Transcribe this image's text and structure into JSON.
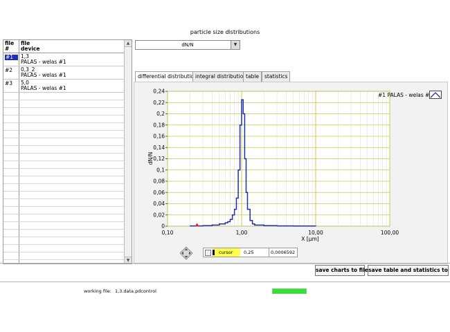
{
  "window": {
    "title": "particle size distributions"
  },
  "file_table": {
    "headers": {
      "file_num": "file\n#",
      "file_device": "file\ndevice"
    },
    "rows": [
      {
        "num": "#1",
        "name": "1,3",
        "device": "PALAS - welas #1",
        "selected": true
      },
      {
        "num": "#2",
        "name": "0,3_2",
        "device": "PALAS - welas #1",
        "selected": false
      },
      {
        "num": "#3",
        "name": "5,0",
        "device": "PALAS - welas #1",
        "selected": false
      }
    ]
  },
  "dropdown": {
    "value": "dN/N"
  },
  "tabs": [
    {
      "label": "differential distribution",
      "active": true
    },
    {
      "label": "integral distribution",
      "active": false
    },
    {
      "label": "table",
      "active": false
    },
    {
      "label": "statistics",
      "active": false
    }
  ],
  "legend": {
    "label": "#1 PALAS - welas #1"
  },
  "cursor": {
    "name": "cursor",
    "x": "0,25",
    "y": "0,0006592"
  },
  "buttons": {
    "save_charts": "save charts to file",
    "save_table": "save table and statistics to file"
  },
  "status": {
    "label": "working file:",
    "file": "1,3.data.pdcontrol",
    "progress": 1.0
  },
  "colors": {
    "series": "#1f2fa0",
    "grid": "#c8c84a",
    "selection": "#1c2fb8",
    "progress": "#33e033",
    "cursor_bg": "#ffff4d"
  },
  "chart_data": {
    "type": "line",
    "xscale": "log",
    "xlim": [
      0.1,
      100
    ],
    "ylim": [
      0,
      0.24
    ],
    "xlabel": "X [µm]",
    "ylabel": "dN/N",
    "xticks": [
      "0,10",
      "1,00",
      "10,00",
      "100,00"
    ],
    "yticks": [
      "0",
      "0,02",
      "0,04",
      "0,06",
      "0,08",
      "0,1",
      "0,12",
      "0,14",
      "0,16",
      "0,18",
      "0,2",
      "0,22",
      "0,24"
    ],
    "grid": true,
    "legend_position": "top-right",
    "series": [
      {
        "name": "#1 PALAS - welas #1",
        "x": [
          0.2,
          0.3,
          0.4,
          0.5,
          0.6,
          0.65,
          0.7,
          0.75,
          0.8,
          0.85,
          0.9,
          0.95,
          1.0,
          1.05,
          1.1,
          1.15,
          1.2,
          1.3,
          1.4,
          1.5,
          2,
          3,
          5,
          10
        ],
        "y": [
          0.0005,
          0.001,
          0.002,
          0.004,
          0.006,
          0.008,
          0.012,
          0.02,
          0.03,
          0.05,
          0.1,
          0.18,
          0.225,
          0.2,
          0.12,
          0.06,
          0.03,
          0.01,
          0.004,
          0.002,
          0.001,
          0.0005,
          0.0003,
          0.0002
        ]
      }
    ],
    "cursor_point": {
      "x": 0.25,
      "y": 0.0006592
    }
  }
}
